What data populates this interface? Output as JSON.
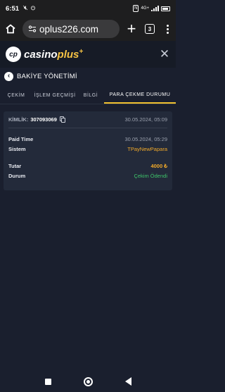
{
  "status_bar": {
    "time": "6:51",
    "notif_icons": [
      "mute-icon",
      "alarm-icon"
    ],
    "nfc_label": "N",
    "network_label": "4G+"
  },
  "browser": {
    "url": "oplus226.com",
    "tab_count": "3"
  },
  "site": {
    "logo_badge": "cp",
    "logo_word_1": "casino",
    "logo_word_2": "plus",
    "logo_sup": "+",
    "close": "✕"
  },
  "page": {
    "back_glyph": "‹",
    "title": "BAKİYE YÖNETİMİ"
  },
  "tabs": [
    {
      "label": "ÇEKİM",
      "active": false
    },
    {
      "label": "İŞLEM GEÇMİŞİ",
      "active": false
    },
    {
      "label": "BİLGİ",
      "active": false
    },
    {
      "label": "PARA ÇEKME DURUMU",
      "active": true
    }
  ],
  "transaction": {
    "kimlik_label": "KİMLİK:",
    "kimlik_value": "307093069",
    "created_at": "30.05.2024, 05:09",
    "paid_time_label": "Paid Time",
    "paid_time_value": "30.05.2024, 05:29",
    "system_label": "Sistem",
    "system_value": "TPayNewPapara",
    "amount_label": "Tutar",
    "amount_value": "4000 ₺",
    "status_label": "Durum",
    "status_value": "Çekim Ödendi"
  },
  "colors": {
    "background": "#1a1f2e",
    "card": "#232a3a",
    "accent_gold": "#f0a92a",
    "tab_underline": "#f2c230",
    "success_green": "#3ec46a"
  }
}
